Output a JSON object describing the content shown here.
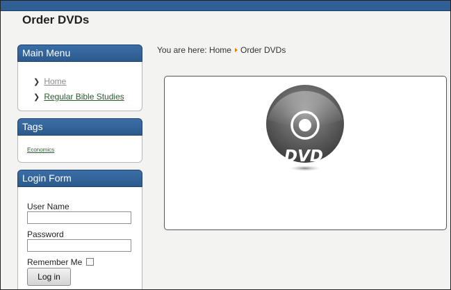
{
  "site": {
    "title": "Order DVDs"
  },
  "main_menu": {
    "title": "Main Menu",
    "items": [
      {
        "label": "Home"
      },
      {
        "label": "Regular Bible Studies"
      }
    ]
  },
  "tags": {
    "title": "Tags",
    "items": [
      {
        "label": "Economics"
      }
    ]
  },
  "login_form": {
    "title": "Login Form",
    "username_label": "User Name",
    "username_value": "",
    "password_label": "Password",
    "password_value": "",
    "remember_label": "Remember Me",
    "remember_checked": false,
    "login_button": "Log in"
  },
  "breadcrumb": {
    "prefix": "You are here:",
    "items": [
      {
        "label": "Home"
      },
      {
        "label": "Order DVDs"
      }
    ]
  },
  "content": {
    "image_label": "DVD",
    "image_icon": "dvd-disc-icon"
  },
  "colors": {
    "header_bar": "#2f5f94",
    "module_header": "#2c5a8c",
    "breadcrumb_separator": "#e07b00",
    "link": "#2b5a30"
  }
}
